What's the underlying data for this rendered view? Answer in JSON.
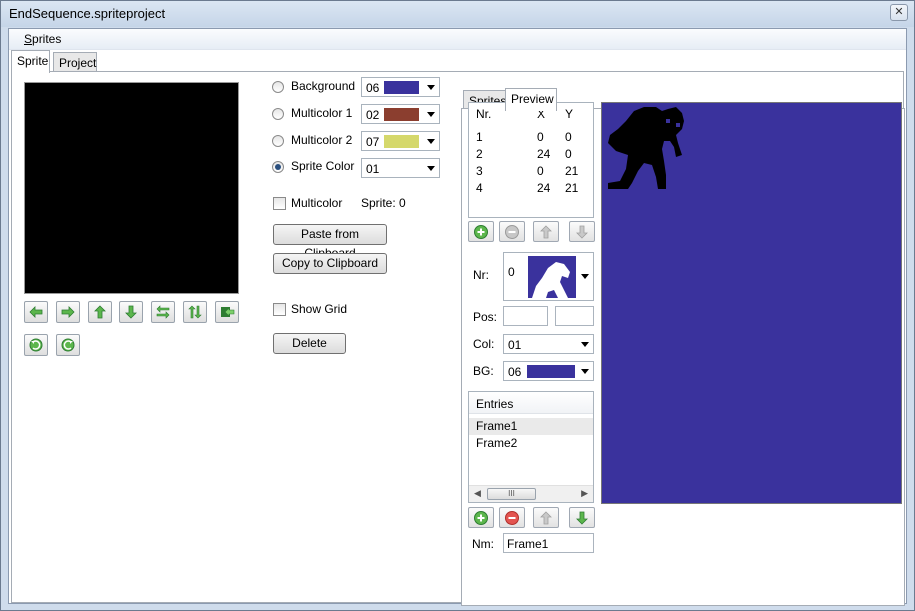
{
  "window": {
    "title": "EndSequence.spriteproject",
    "close_glyph": "✕"
  },
  "menu": {
    "sprites_label_first": "S",
    "sprites_label_rest": "prites"
  },
  "tabs": {
    "sprite": "Sprite",
    "project": "Project"
  },
  "colors": {
    "background": {
      "label": "Background",
      "value": "06",
      "swatch": "#3a329d"
    },
    "multicolor1": {
      "label": "Multicolor 1",
      "value": "02",
      "swatch": "#8b3e2f"
    },
    "multicolor2": {
      "label": "Multicolor 2",
      "value": "07",
      "swatch": "#d5d86b"
    },
    "sprite_color": {
      "label": "Sprite Color",
      "value": "01"
    },
    "selected": "sprite_color"
  },
  "multicolor": {
    "label": "Multicolor",
    "checked": false
  },
  "sprite_index": "Sprite: 0",
  "buttons": {
    "paste": "Paste from Clipboard",
    "copy": "Copy to Clipboard",
    "show_grid": "Show Grid",
    "delete": "Delete"
  },
  "toolbar_icons": [
    "shift-left-icon",
    "shift-right-icon",
    "shift-up-icon",
    "shift-down-icon",
    "flip-horizontal-icon",
    "flip-vertical-icon",
    "invert-icon",
    "rotate-left-icon",
    "rotate-right-icon"
  ],
  "subtabs": {
    "sprites": "Sprites",
    "preview": "Preview"
  },
  "sprite_list": {
    "headers": [
      "Nr.",
      "X",
      "Y"
    ],
    "rows": [
      [
        "1",
        "0",
        "0"
      ],
      [
        "2",
        "24",
        "0"
      ],
      [
        "3",
        "0",
        "21"
      ],
      [
        "4",
        "24",
        "21"
      ]
    ]
  },
  "fields": {
    "nr_label": "Nr:",
    "nr_value": "0",
    "pos_label": "Pos:",
    "col_label": "Col:",
    "col_value": "01",
    "bg_label": "BG:",
    "bg_value": "06",
    "bg_swatch": "#3a329d"
  },
  "entries": {
    "header": "Entries",
    "items": [
      "Frame1",
      "Frame2"
    ],
    "scroll_thumb": "III"
  },
  "name_field": {
    "label": "Nm:",
    "value": "Frame1"
  }
}
